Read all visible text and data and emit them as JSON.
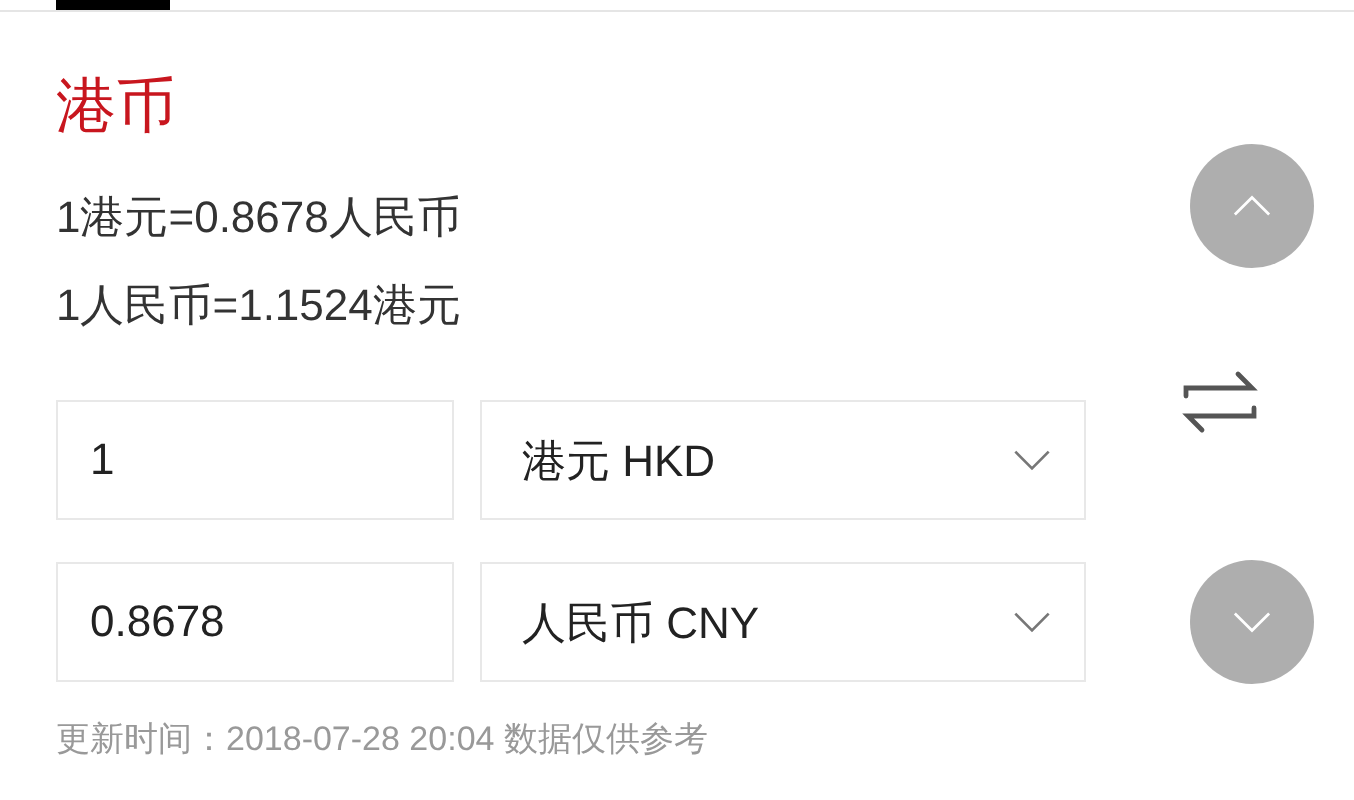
{
  "title": "港币",
  "rates": [
    "1港元=0.8678人民币",
    "1人民币=1.1524港元"
  ],
  "converter": [
    {
      "amount": "1",
      "currency": "港元 HKD"
    },
    {
      "amount": "0.8678",
      "currency": "人民币 CNY"
    }
  ],
  "footer": "更新时间：2018-07-28 20:04 数据仅供参考"
}
